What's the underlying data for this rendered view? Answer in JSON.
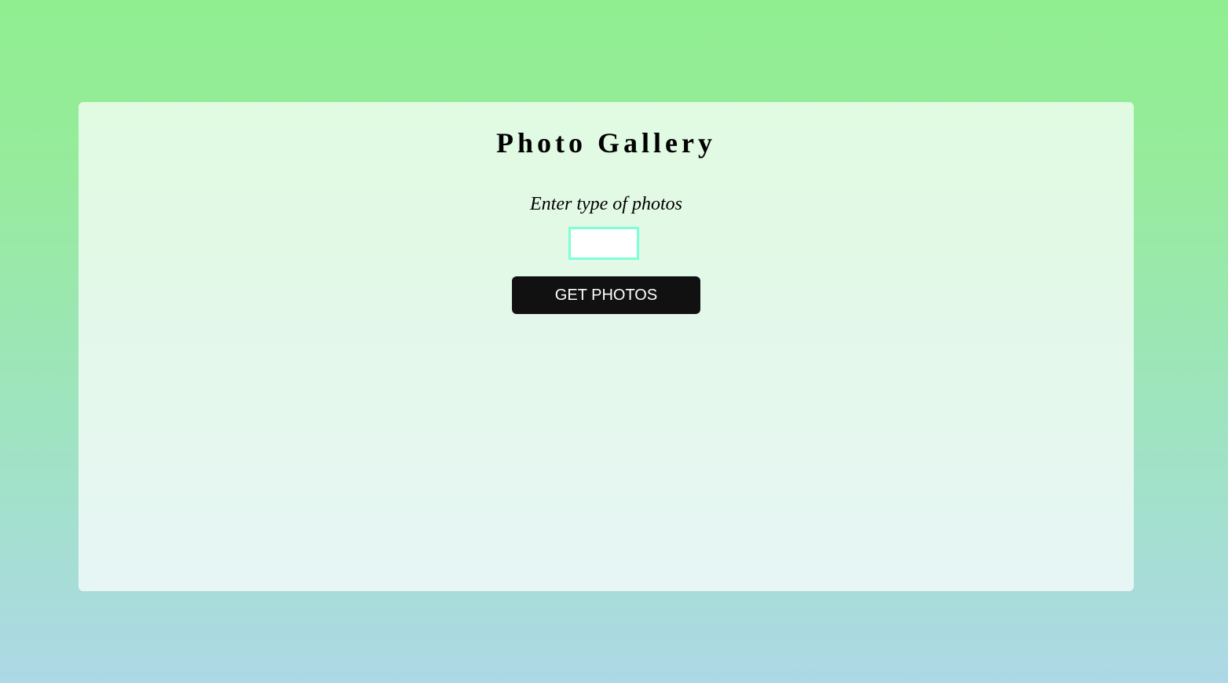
{
  "gallery": {
    "title": "Photo Gallery",
    "prompt": "Enter type of photos",
    "search": {
      "value": "",
      "placeholder": ""
    },
    "button_label": "GET PHOTOS"
  },
  "colors": {
    "background_top": "#90ee90",
    "background_bottom": "#add8e6",
    "input_border": "#7fffd4",
    "button_background": "#111111",
    "button_text": "#ffffff"
  }
}
